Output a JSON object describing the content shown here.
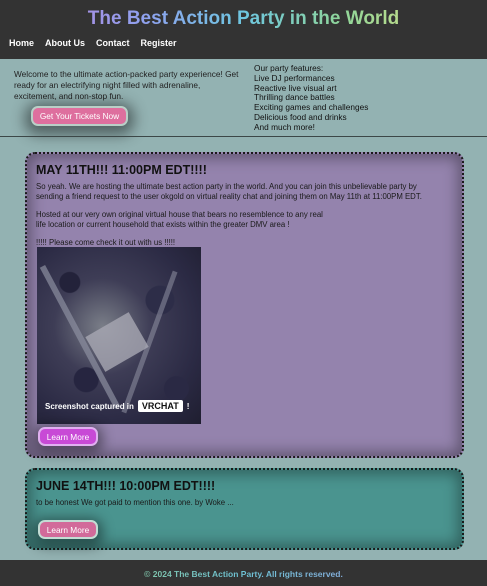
{
  "header": {
    "title": "The Best Action Party in the World",
    "nav": [
      "Home",
      "About Us",
      "Contact",
      "Register"
    ]
  },
  "hero": {
    "intro": "Welcome to the ultimate action-packed party experience! Get ready for an electrifying night filled with adrenaline, excitement, and non-stop fun.",
    "tickets_label": "Get Your Tickets Now",
    "features_heading": "Our party features:",
    "features": [
      "Live DJ performances",
      "Reactive live visual art",
      "Thrilling dance battles",
      "Exciting games and challenges",
      "Delicious food and drinks",
      "And much more!"
    ]
  },
  "events": [
    {
      "title": "MAY 11TH!!! 11:00PM EDT!!!!",
      "paragraphs": [
        "So yeah. We are hosting the ultimate best action party in the world. And you can join this unbelievable party by sending a friend request to the user okgold on virtual reality chat and joining them on May 11th at 11:00PM EDT.",
        "Hosted at our very own original virtual house that bears no resemblence to any real life location or current household that exists within the greater DMV area !",
        "!!!!! Please come check it out with us !!!!!"
      ],
      "image_caption": "Screenshot captured in",
      "image_logo": "VRCHAT",
      "image_suffix": "!",
      "learn_label": "Learn More",
      "accent": "#9483ad"
    },
    {
      "title": "JUNE 14TH!!! 10:00PM EDT!!!!",
      "paragraphs": [
        "to be honest We got paid to mention this one. by Woke ..."
      ],
      "learn_label": "Learn More",
      "accent": "#4a948f"
    }
  ],
  "footer": {
    "text": "© 2024 The Best Action Party. All rights reserved."
  },
  "colors": {
    "background": "#93b2b2",
    "header_bg": "#333333",
    "ticket_button": "#de6f9e",
    "learn_button_1": "#c84ad6",
    "learn_button_2": "#d26a9a"
  }
}
